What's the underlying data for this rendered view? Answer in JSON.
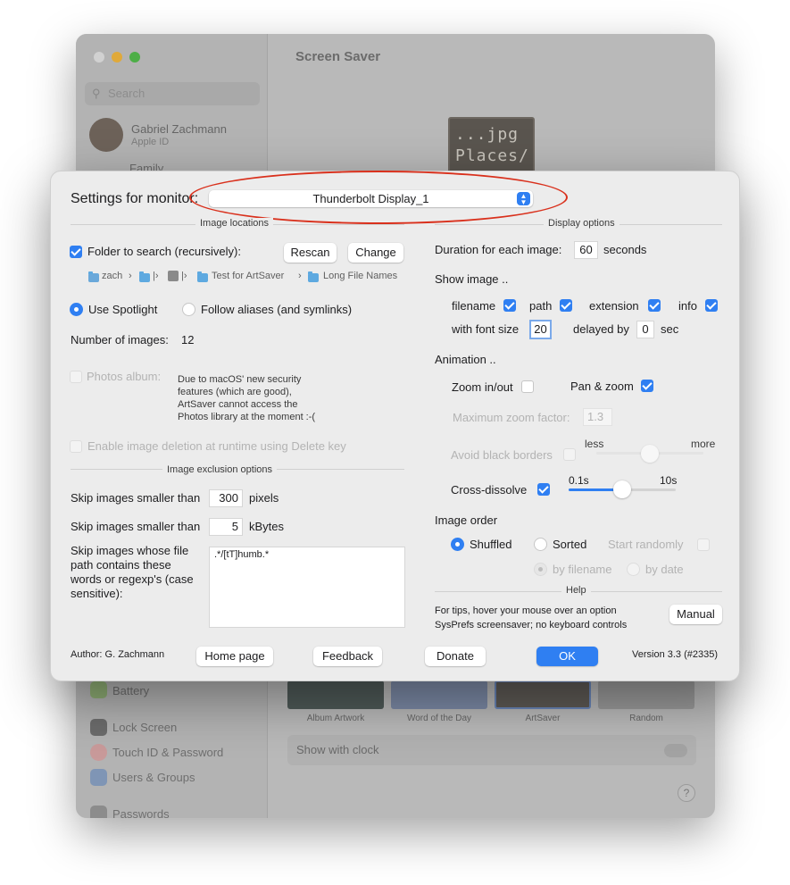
{
  "background_window": {
    "title": "Screen Saver",
    "search_placeholder": "Search",
    "user_name": "Gabriel Zachmann",
    "user_sub": "Apple ID",
    "sidebar_partial": "Family",
    "sidebar_items": [
      "Battery",
      "Lock Screen",
      "Touch ID & Password",
      "Users & Groups",
      "Passwords"
    ],
    "preview_text": [
      "...jpg",
      "Places/"
    ],
    "thumbnails": [
      "Album Artwork",
      "Word of the Day",
      "ArtSaver",
      "Random"
    ],
    "show_with_clock": "Show with clock",
    "help": "?"
  },
  "dialog": {
    "monitor_label": "Settings for monitor:",
    "monitor_value": "Thunderbolt Display_1",
    "sections": {
      "image_locations": "Image locations",
      "display_options": "Display options",
      "image_exclusion": "Image exclusion options",
      "help": "Help"
    },
    "left": {
      "folder_label": "Folder to search (recursively):",
      "rescan": "Rescan",
      "change": "Change",
      "breadcrumb": [
        "zach",
        "›",
        "|›",
        "|›",
        "Test for ArtSaver",
        "›",
        "Long File Names"
      ],
      "use_spotlight": "Use Spotlight",
      "follow_aliases": "Follow aliases (and symlinks)",
      "num_images_label": "Number of images:",
      "num_images_value": "12",
      "photos_album": "Photos album:",
      "photos_note": [
        "Due to macOS' new security",
        "features (which are good),",
        "ArtSaver cannot access the",
        "Photos library at the moment :-("
      ],
      "enable_deletion": "Enable image deletion at runtime using Delete key",
      "skip_pixels_label": "Skip images smaller than",
      "skip_pixels_value": "300",
      "skip_pixels_unit": "pixels",
      "skip_kbytes_label": "Skip images smaller than",
      "skip_kbytes_value": "5",
      "skip_kbytes_unit": "kBytes",
      "skip_regex_label": [
        "Skip images whose file",
        "path contains these",
        "words or regexp's (case",
        "sensitive):"
      ],
      "skip_regex_value": ".*/[tT]humb.*"
    },
    "right": {
      "duration_label": "Duration for each image:",
      "duration_value": "60",
      "duration_unit": "seconds",
      "show_image": "Show image ..",
      "filename": "filename",
      "path": "path",
      "extension": "extension",
      "info": "info",
      "font_size_label": "with font size",
      "font_size_value": "20",
      "delayed_by": "delayed by",
      "delay_value": "0",
      "delay_unit": "sec",
      "animation": "Animation ..",
      "zoom_inout": "Zoom in/out",
      "pan_zoom": "Pan & zoom",
      "max_zoom_label": "Maximum zoom factor:",
      "max_zoom_value": "1.3",
      "avoid_black": "Avoid black borders",
      "less": "less",
      "more": "more",
      "avoid_slider_level": 0.5,
      "cross_dissolve": "Cross-dissolve",
      "cd_min": "0.1s",
      "cd_max": "10s",
      "cd_slider_level": 0.5,
      "image_order": "Image order",
      "shuffled": "Shuffled",
      "sorted": "Sorted",
      "start_randomly": "Start randomly",
      "by_filename": "by filename",
      "by_date": "by date",
      "tips": [
        "For tips, hover your mouse over an option",
        "SysPrefs screensaver; no keyboard controls"
      ],
      "manual": "Manual"
    },
    "footer": {
      "author": "Author: G. Zachmann",
      "home_page": "Home page",
      "feedback": "Feedback",
      "donate": "Donate",
      "ok": "OK",
      "version": "Version 3.3 (#2335)"
    }
  },
  "colors": {
    "accent": "#2f7ff2",
    "annotation": "#d9301c"
  }
}
